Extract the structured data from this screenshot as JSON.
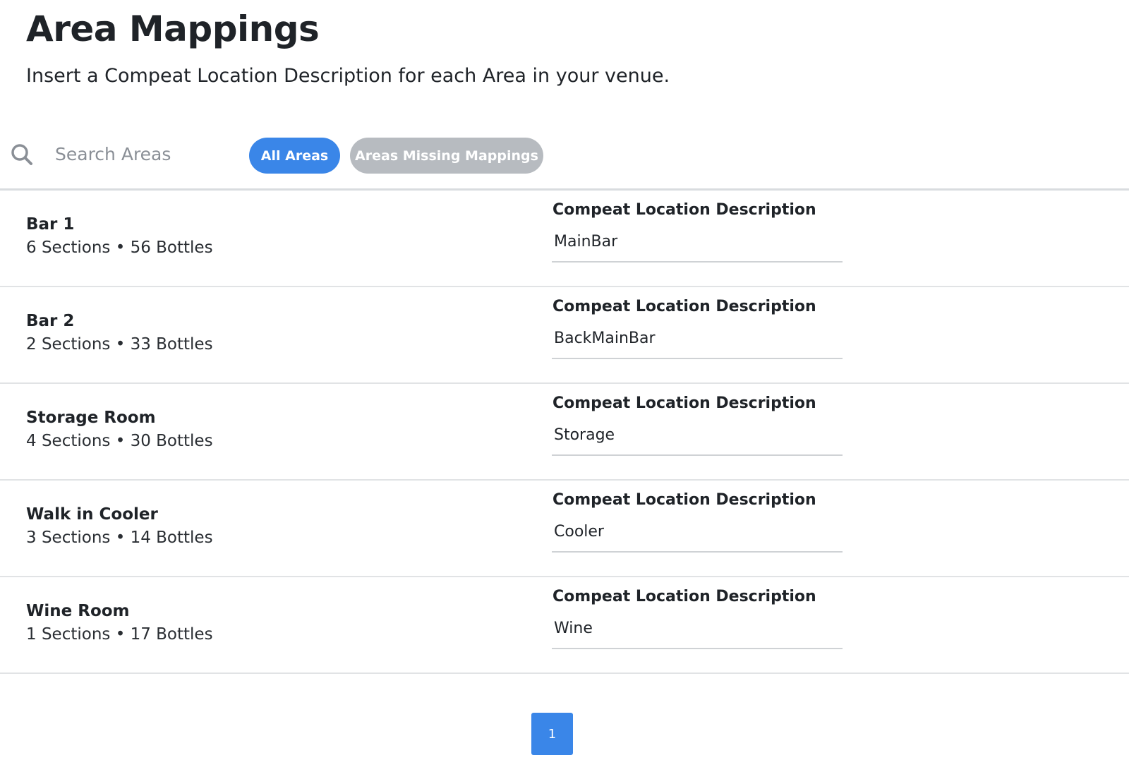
{
  "header": {
    "title": "Area Mappings",
    "subtitle": "Insert a Compeat Location Description for each Area in your venue."
  },
  "toolbar": {
    "search_placeholder": "Search Areas",
    "search_value": "",
    "filters": [
      {
        "label": "All Areas",
        "active": true
      },
      {
        "label": "Areas Missing Mappings",
        "active": false
      }
    ]
  },
  "colors": {
    "accent": "#3a86e8",
    "inactive_pill": "#b7bbc0"
  },
  "areas": [
    {
      "name": "Bar 1",
      "meta": "6 Sections • 56 Bottles",
      "field_label": "Compeat Location Description",
      "value": "MainBar"
    },
    {
      "name": "Bar 2",
      "meta": "2 Sections • 33 Bottles",
      "field_label": "Compeat Location Description",
      "value": "BackMainBar"
    },
    {
      "name": "Storage Room",
      "meta": "4 Sections • 30 Bottles",
      "field_label": "Compeat Location Description",
      "value": "Storage"
    },
    {
      "name": "Walk in Cooler",
      "meta": "3 Sections • 14 Bottles",
      "field_label": "Compeat Location Description",
      "value": "Cooler"
    },
    {
      "name": "Wine Room",
      "meta": "1 Sections • 17 Bottles",
      "field_label": "Compeat Location Description",
      "value": "Wine"
    }
  ],
  "pagination": {
    "current_page": "1"
  }
}
